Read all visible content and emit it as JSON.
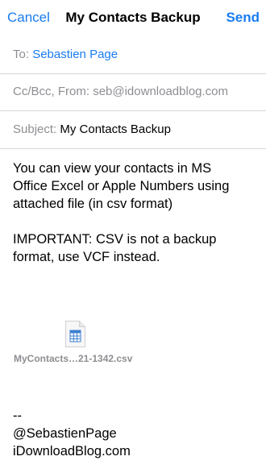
{
  "nav": {
    "cancel": "Cancel",
    "title": "My Contacts Backup",
    "send": "Send"
  },
  "to": {
    "label": "To:",
    "value": "Sebastien Page"
  },
  "cc": {
    "label": "Cc/Bcc, From:",
    "value": "seb@idownloadblog.com"
  },
  "subject": {
    "label": "Subject:",
    "value": "My Contacts Backup"
  },
  "body": {
    "line1": "You can view your contacts in MS",
    "line2": "Office Excel or Apple Numbers using",
    "line3": "attached file (in csv format)",
    "line4": "IMPORTANT: CSV is not a backup",
    "line5": "format, use VCF instead."
  },
  "attachment": {
    "icon": "spreadsheet-file-icon",
    "name": "MyContacts…21-1342.csv"
  },
  "signature": {
    "dashes": "--",
    "handle": "@SebastienPage",
    "site": "iDownloadBlog.com"
  },
  "colors": {
    "accent": "#1a7cf0",
    "secondary_text": "#8e8e93",
    "separator": "#d6d6d9"
  }
}
